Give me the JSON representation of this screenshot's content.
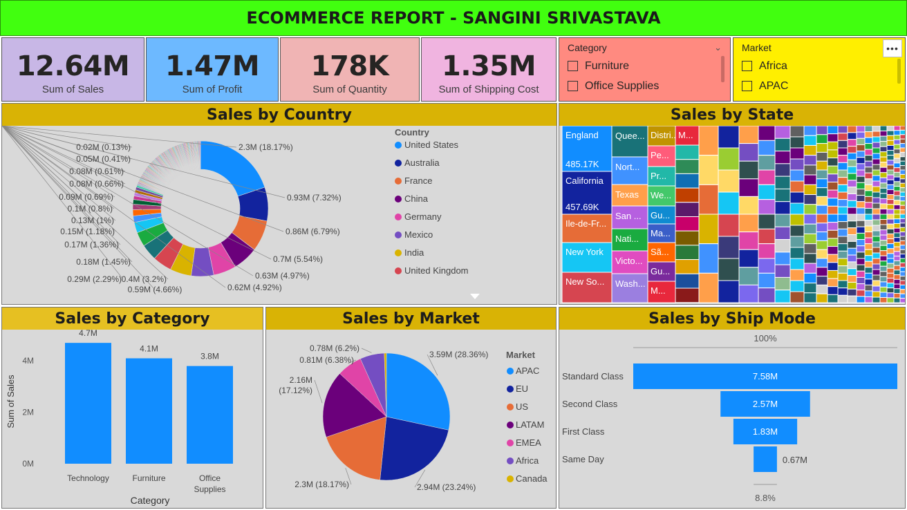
{
  "title": "ECOMMERCE REPORT - SANGINI SRIVASTAVA",
  "kpis": [
    {
      "value": "12.64M",
      "label": "Sum of Sales",
      "color": "#c8b7e6"
    },
    {
      "value": "1.47M",
      "label": "Sum of Profit",
      "color": "#6db9ff"
    },
    {
      "value": "178K",
      "label": "Sum of Quantity",
      "color": "#f0b4b4"
    },
    {
      "value": "1.35M",
      "label": "Sum of Shipping Cost",
      "color": "#f0b4e0"
    }
  ],
  "slicers": {
    "category": {
      "title": "Category",
      "options": [
        "Furniture",
        "Office Supplies"
      ],
      "color": "#ff8a80"
    },
    "market": {
      "title": "Market",
      "options": [
        "Africa",
        "APAC"
      ],
      "color": "#ffef00"
    }
  },
  "panels": {
    "country": "Sales by Country",
    "state": "Sales by State",
    "category": "Sales by Category",
    "market": "Sales by Market",
    "shipmode": "Sales by Ship Mode"
  },
  "icons": {
    "more_options": "ellipsis-icon",
    "dropdown": "chevron-down-icon",
    "scroll": "scroll-down-icon"
  },
  "chart_data": [
    {
      "id": "country",
      "type": "pie",
      "title": "Sales by Country",
      "legend_title": "Country",
      "legend_position": "right",
      "slices": [
        {
          "name": "United States",
          "value": 2.3,
          "label": "2.3M (18.17%)",
          "color": "#118dff"
        },
        {
          "name": "Australia",
          "value": 0.93,
          "label": "0.93M (7.32%)",
          "color": "#12239e"
        },
        {
          "name": "France",
          "value": 0.86,
          "label": "0.86M (6.79%)",
          "color": "#e66c37"
        },
        {
          "name": "China",
          "value": 0.7,
          "label": "0.7M (5.54%)",
          "color": "#6b007b"
        },
        {
          "name": "Germany",
          "value": 0.63,
          "label": "0.63M (4.97%)",
          "color": "#e044a7"
        },
        {
          "name": "Mexico",
          "value": 0.62,
          "label": "0.62M (4.92%)",
          "color": "#744ec2"
        },
        {
          "name": "India",
          "value": 0.59,
          "label": "0.59M (4.66%)",
          "color": "#d9b300"
        },
        {
          "name": "United Kingdom",
          "value": 0.53,
          "label": "",
          "color": "#d64550"
        },
        {
          "name": "",
          "value": 0.45,
          "label": "",
          "color": "#197278"
        },
        {
          "name": "",
          "value": 0.4,
          "label": "0.4M (3.2%)",
          "color": "#1aab40"
        },
        {
          "name": "",
          "value": 0.29,
          "label": "0.29M (2.29%)",
          "color": "#15c6f4"
        },
        {
          "name": "",
          "value": 0.18,
          "label": "0.18M (1.45%)",
          "color": "#4092ff"
        },
        {
          "name": "",
          "value": 0.17,
          "label": "0.17M (1.36%)",
          "color": "#ff6600"
        },
        {
          "name": "",
          "value": 0.15,
          "label": "0.15M (1.18%)",
          "color": "#a43b76"
        },
        {
          "name": "",
          "value": 0.13,
          "label": "0.13M (1%)",
          "color": "#005f33"
        },
        {
          "name": "",
          "value": 0.1,
          "label": "0.1M (0.8%)",
          "color": "#c8348f"
        },
        {
          "name": "",
          "value": 0.09,
          "label": "0.09M (0.69%)",
          "color": "#bf79e0"
        },
        {
          "name": "",
          "value": 0.08,
          "label": "0.08M (0.66%)",
          "color": "#b36b00"
        },
        {
          "name": "",
          "value": 0.08,
          "label": "0.08M (0.61%)",
          "color": "#6e4c9c"
        },
        {
          "name": "",
          "value": 0.05,
          "label": "0.05M (0.41%)",
          "color": "#2fd1a6"
        },
        {
          "name": "",
          "value": 0.02,
          "label": "0.02M (0.13%)",
          "color": "#8a8a8a"
        }
      ],
      "tail": {
        "count": 130,
        "total": 2.22
      }
    },
    {
      "id": "state",
      "type": "treemap",
      "title": "Sales by State",
      "labeled_tiles": [
        {
          "name": "England",
          "value": "485.17K",
          "color": "#118dff"
        },
        {
          "name": "California",
          "value": "457.69K",
          "color": "#12239e"
        },
        {
          "name": "Ile-de-Fr...",
          "value": "",
          "color": "#e66c37"
        },
        {
          "name": "New York",
          "value": "",
          "color": "#15c6f4"
        },
        {
          "name": "New So...",
          "value": "",
          "color": "#d64550"
        },
        {
          "name": "Quee...",
          "value": "",
          "color": "#197278"
        },
        {
          "name": "Nort...",
          "value": "",
          "color": "#4092ff"
        },
        {
          "name": "Texas",
          "value": "",
          "color": "#ff9f4a"
        },
        {
          "name": "San ...",
          "value": "",
          "color": "#b660e0"
        },
        {
          "name": "Nati...",
          "value": "",
          "color": "#1aab40"
        },
        {
          "name": "Victo...",
          "value": "",
          "color": "#e04cc0"
        },
        {
          "name": "Wash...",
          "value": "",
          "color": "#9b7fe0"
        },
        {
          "name": "Distri...",
          "value": "",
          "color": "#c09300"
        },
        {
          "name": "Pe...",
          "value": "",
          "color": "#ff5c7a"
        },
        {
          "name": "Pr...",
          "value": "",
          "color": "#22b8a8"
        },
        {
          "name": "We...",
          "value": "",
          "color": "#43c86a"
        },
        {
          "name": "Gu...",
          "value": "",
          "color": "#0f8bd1"
        },
        {
          "name": "Ma...",
          "value": "",
          "color": "#3a5ec8"
        },
        {
          "name": "Sã...",
          "value": "",
          "color": "#ff6600"
        },
        {
          "name": "Gu...",
          "value": "",
          "color": "#7a2a9c"
        },
        {
          "name": "M...",
          "value": "",
          "color": "#e8283c"
        }
      ]
    },
    {
      "id": "category",
      "type": "bar",
      "title": "Sales by Category",
      "categories": [
        "Technology",
        "Furniture",
        "Office\nSupplies"
      ],
      "values": [
        4.7,
        4.1,
        3.8
      ],
      "value_labels": [
        "4.7M",
        "4.1M",
        "3.8M"
      ],
      "xlabel": "Category",
      "ylabel": "Sum of Sales",
      "yticks": [
        "0M",
        "2M",
        "4M"
      ],
      "ylim": [
        0,
        5
      ],
      "color": "#118dff"
    },
    {
      "id": "market",
      "type": "pie",
      "title": "Sales by Market",
      "legend_title": "Market",
      "legend_position": "right",
      "slices": [
        {
          "name": "APAC",
          "value": 3.59,
          "label": "3.59M (28.36%)",
          "color": "#118dff"
        },
        {
          "name": "EU",
          "value": 2.94,
          "label": "2.94M (23.24%)",
          "color": "#12239e"
        },
        {
          "name": "US",
          "value": 2.3,
          "label": "2.3M (18.17%)",
          "color": "#e66c37"
        },
        {
          "name": "LATAM",
          "value": 2.16,
          "label": "2.16M\n(17.12%)",
          "color": "#6b007b"
        },
        {
          "name": "EMEA",
          "value": 0.81,
          "label": "0.81M (6.38%)",
          "color": "#e044a7"
        },
        {
          "name": "Africa",
          "value": 0.78,
          "label": "0.78M (6.2%)",
          "color": "#744ec2"
        },
        {
          "name": "Canada",
          "value": 0.07,
          "label": "",
          "color": "#d9b300"
        }
      ]
    },
    {
      "id": "shipmode",
      "type": "bar",
      "orientation": "horizontal",
      "title": "Sales by Ship Mode",
      "categories": [
        "Standard Class",
        "Second Class",
        "First Class",
        "Same Day"
      ],
      "values": [
        7.58,
        2.57,
        1.83,
        0.67
      ],
      "value_labels": [
        "7.58M",
        "2.57M",
        "1.83M",
        "0.67M"
      ],
      "top_label": "100%",
      "bottom_label": "8.8%",
      "color": "#118dff"
    }
  ]
}
